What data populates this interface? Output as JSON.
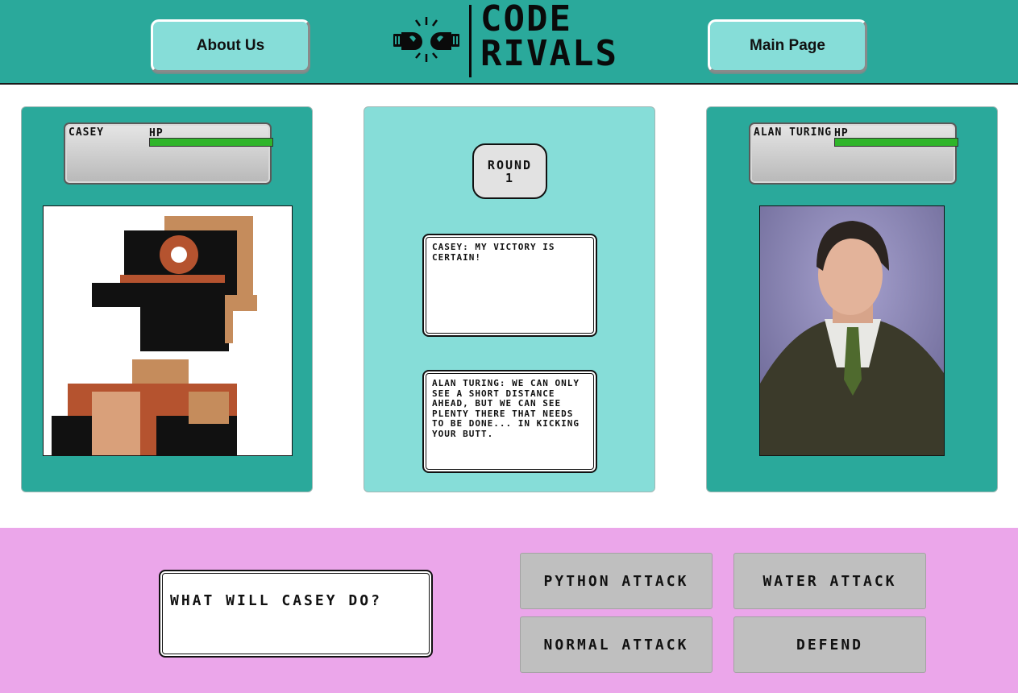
{
  "header": {
    "about_label": "About Us",
    "main_label": "Main Page",
    "logo_line1": "CODE",
    "logo_line2": "RIVALS"
  },
  "player": {
    "name": "CASEY",
    "hp_label": "HP",
    "hp_fraction": 1.0
  },
  "enemy": {
    "name": "ALAN TURING",
    "hp_label": "HP",
    "hp_fraction": 1.0
  },
  "round": {
    "label": "ROUND",
    "number": "1"
  },
  "dialog": {
    "player_line": "CASEY: MY VICTORY IS CERTAIN!",
    "enemy_line": "ALAN TURING: WE CAN ONLY SEE A SHORT DISTANCE AHEAD, BUT WE CAN SEE PLENTY THERE THAT NEEDS TO BE DONE... IN KICKING YOUR BUTT."
  },
  "actions": {
    "prompt": "WHAT WILL CASEY DO?",
    "python_attack": "PYTHON ATTACK",
    "water_attack": "WATER ATTACK",
    "normal_attack": "NORMAL ATTACK",
    "defend": "DEFEND"
  },
  "colors": {
    "header_bg": "#2aa99b",
    "panel_teal": "#2aa99b",
    "panel_light": "#86ddd8",
    "action_bg": "#eba6ea",
    "hp_green": "#2fb52a",
    "button_gray": "#bfbfbf"
  }
}
